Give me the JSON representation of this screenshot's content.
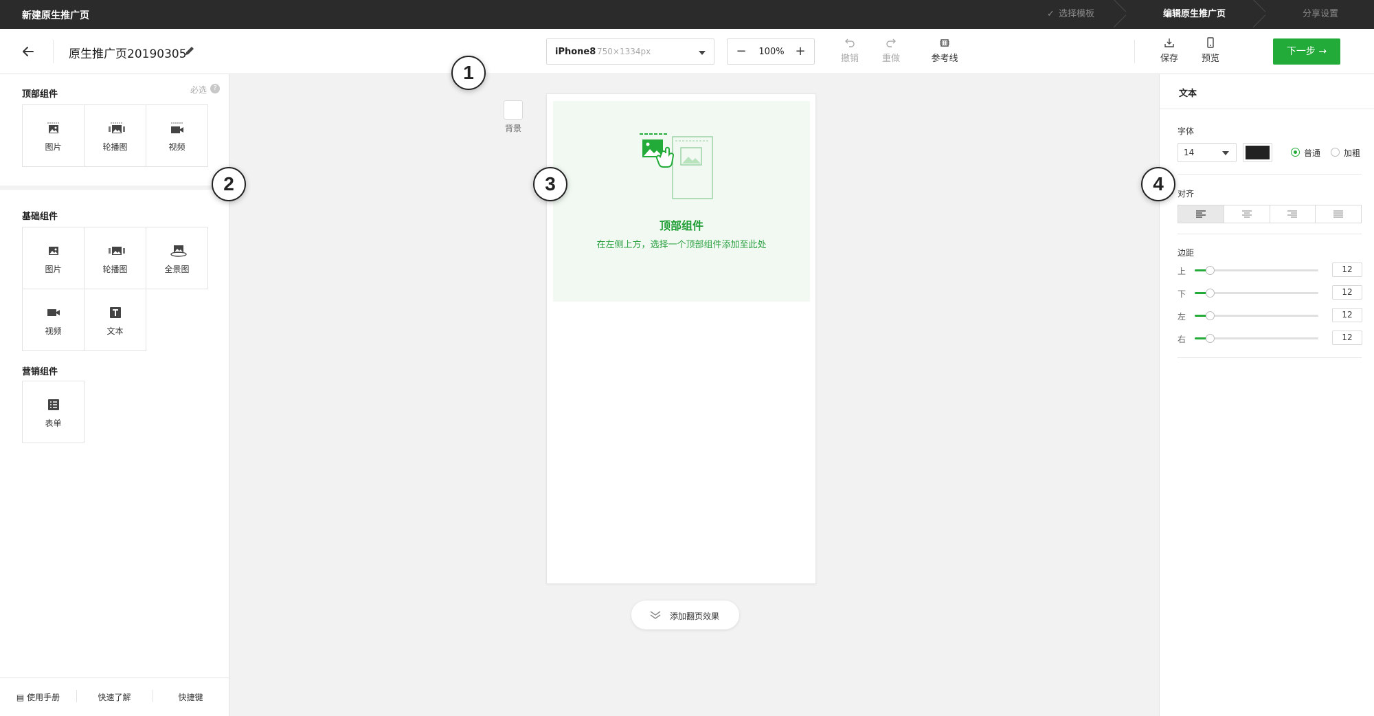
{
  "app": {
    "title": "新建原生推广页"
  },
  "steps": [
    {
      "label": "选择模板",
      "state": "done"
    },
    {
      "label": "编辑原生推广页",
      "state": "active"
    },
    {
      "label": "分享设置",
      "state": "pending"
    }
  ],
  "toolbar": {
    "page_name": "原生推广页20190305",
    "device": {
      "name": "iPhone8",
      "size": "750×1334px"
    },
    "zoom": "100%",
    "undo": "撤销",
    "redo": "重做",
    "guides": "参考线",
    "save": "保存",
    "preview": "预览",
    "next": "下一步"
  },
  "left_panel": {
    "top_components": {
      "title": "顶部组件",
      "required": "必选",
      "items": [
        {
          "label": "图片",
          "icon": "image-icon"
        },
        {
          "label": "轮播图",
          "icon": "carousel-icon"
        },
        {
          "label": "视频",
          "icon": "video-icon"
        }
      ]
    },
    "basic_components": {
      "title": "基础组件",
      "items": [
        {
          "label": "图片",
          "icon": "image-icon"
        },
        {
          "label": "轮播图",
          "icon": "carousel-icon"
        },
        {
          "label": "全景图",
          "icon": "panorama-icon"
        },
        {
          "label": "视频",
          "icon": "video-icon"
        },
        {
          "label": "文本",
          "icon": "text-icon"
        }
      ]
    },
    "marketing_components": {
      "title": "营销组件",
      "items": [
        {
          "label": "表单",
          "icon": "form-icon"
        }
      ]
    },
    "footer": [
      "使用手册",
      "快速了解",
      "快捷键"
    ]
  },
  "canvas": {
    "background_label": "背景",
    "placeholder_title": "顶部组件",
    "placeholder_desc": "在左侧上方，选择一个顶部组件添加至此处",
    "page_effect": "添加翻页效果"
  },
  "right_panel": {
    "title": "文本",
    "font_label": "字体",
    "font_size": "14",
    "font_color": "#222222",
    "weight_normal": "普通",
    "weight_bold": "加粗",
    "align_label": "对齐",
    "margin_label": "边距",
    "margins": [
      {
        "label": "上",
        "value": "12",
        "fraction": 0.12
      },
      {
        "label": "下",
        "value": "12",
        "fraction": 0.12
      },
      {
        "label": "左",
        "value": "12",
        "fraction": 0.12
      },
      {
        "label": "右",
        "value": "12",
        "fraction": 0.12
      }
    ]
  },
  "callouts": [
    "1",
    "2",
    "3",
    "4"
  ],
  "colors": {
    "accent": "#22ab38",
    "topbar": "#2b2b2b"
  }
}
